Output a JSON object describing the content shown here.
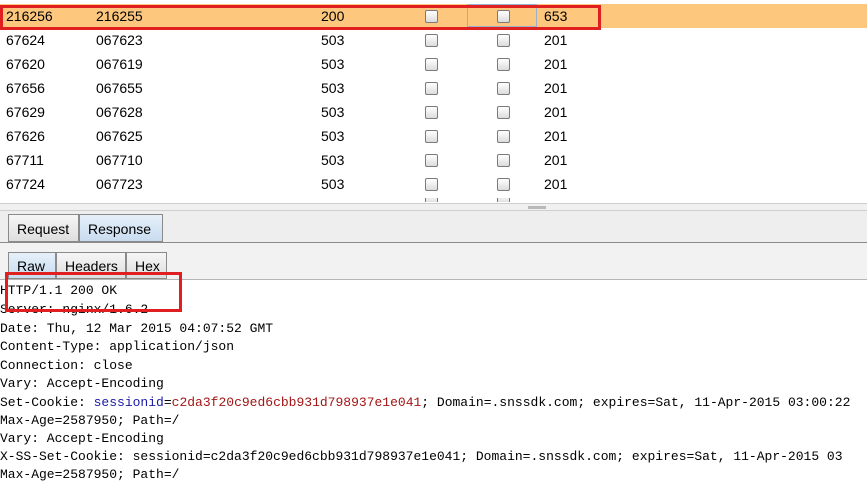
{
  "results": {
    "rows": [
      {
        "request": "216256",
        "payload": "216255",
        "status": "200",
        "length": "653",
        "selected": true
      },
      {
        "request": "67624",
        "payload": "067623",
        "status": "503",
        "length": "201"
      },
      {
        "request": "67620",
        "payload": "067619",
        "status": "503",
        "length": "201"
      },
      {
        "request": "67656",
        "payload": "067655",
        "status": "503",
        "length": "201"
      },
      {
        "request": "67629",
        "payload": "067628",
        "status": "503",
        "length": "201"
      },
      {
        "request": "67626",
        "payload": "067625",
        "status": "503",
        "length": "201"
      },
      {
        "request": "67711",
        "payload": "067710",
        "status": "503",
        "length": "201"
      },
      {
        "request": "67724",
        "payload": "067723",
        "status": "503",
        "length": "201"
      }
    ]
  },
  "tabs": {
    "request": "Request",
    "response": "Response",
    "raw": "Raw",
    "headers": "Headers",
    "hex": "Hex"
  },
  "response": {
    "lines": [
      "HTTP/1.1 200 OK",
      "Server: nginx/1.6.2",
      "Date: Thu, 12 Mar 2015 04:07:52 GMT",
      "Content-Type: application/json",
      "Connection: close",
      "Vary: Accept-Encoding",
      "Set-Cookie: ",
      "Max-Age=2587950; Path=/",
      "Vary: Accept-Encoding",
      "X-SS-Set-Cookie: sessionid=c2da3f20c9ed6cbb931d798937e1e041; Domain=.snssdk.com; expires=Sat, 11-Apr-2015 03",
      "Max-Age=2587950; Path=/"
    ],
    "cookie_name": "sessionid",
    "cookie_eq": "=",
    "cookie_value": "c2da3f20c9ed6cbb931d798937e1e041",
    "cookie_rest": "; Domain=.snssdk.com; expires=Sat, 11-Apr-2015 03:00:22"
  },
  "colors": {
    "selected_row": "#fdc77e",
    "annotation": "#e02020"
  }
}
